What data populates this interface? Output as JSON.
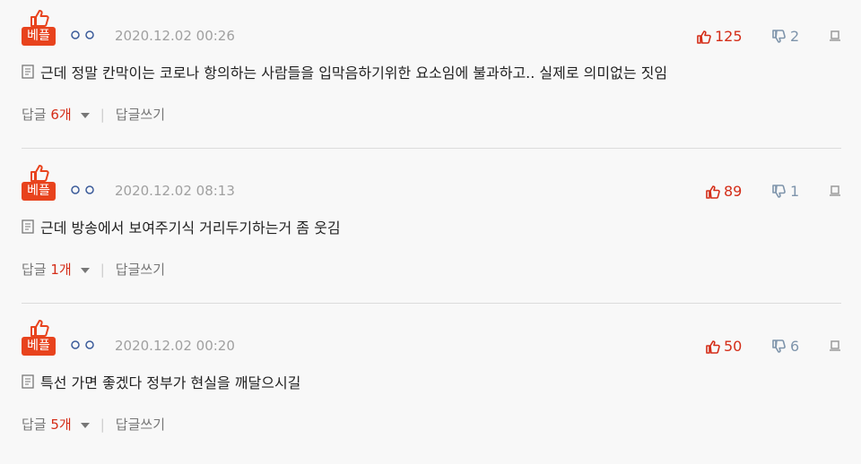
{
  "colors": {
    "accent": "#e8431d",
    "like": "#d42d18",
    "dislike": "#7e94ab",
    "meta": "#a0a0a0"
  },
  "icons": [
    "best-thumb-icon",
    "author-circles-icon",
    "thumbs-up-icon",
    "thumbs-down-icon",
    "report-icon",
    "memo-icon",
    "chevron-down-icon"
  ],
  "comments": [
    {
      "badge": "베플",
      "timestamp": "2020.12.02 00:26",
      "likes": "125",
      "dislikes": "2",
      "text": "근데 정말 칸막이는 코로나 항의하는 사람들을 입막음하기위한 요소임에 불과하고.. 실제로 의미없는 짓임",
      "reply_label": "답글",
      "reply_count": "6개",
      "write_reply": "답글쓰기"
    },
    {
      "badge": "베플",
      "timestamp": "2020.12.02 08:13",
      "likes": "89",
      "dislikes": "1",
      "text": "근데 방송에서 보여주기식 거리두기하는거 좀 웃김",
      "reply_label": "답글",
      "reply_count": "1개",
      "write_reply": "답글쓰기"
    },
    {
      "badge": "베플",
      "timestamp": "2020.12.02 00:20",
      "likes": "50",
      "dislikes": "6",
      "text": "특선 가면 좋겠다 정부가 현실을 깨달으시길",
      "reply_label": "답글",
      "reply_count": "5개",
      "write_reply": "답글쓰기"
    }
  ]
}
